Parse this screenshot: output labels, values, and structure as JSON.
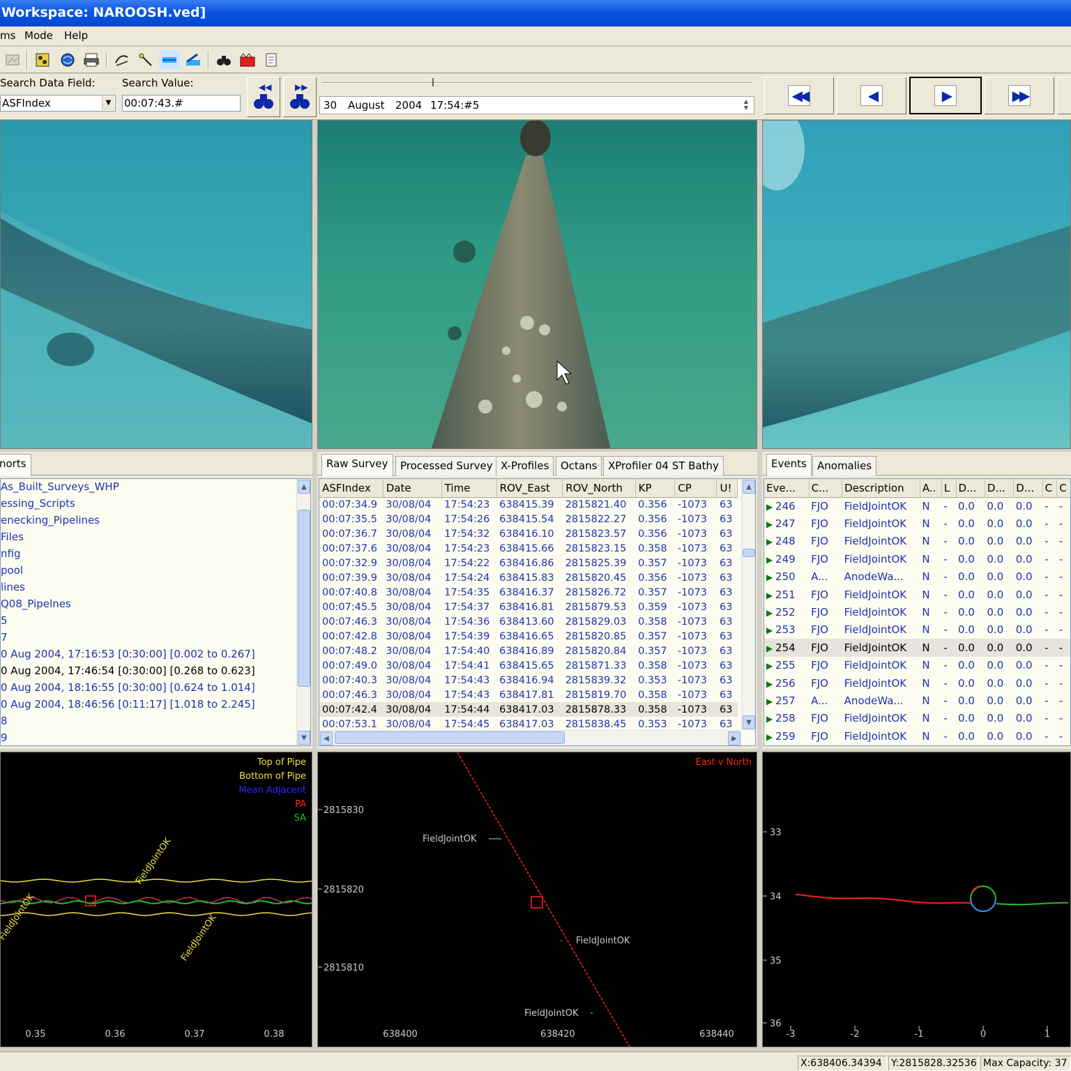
{
  "window": {
    "title": "Workspace: NAROOSH.ved]"
  },
  "menu": [
    "ms",
    "Mode",
    "Help"
  ],
  "toolbar": {
    "icons": [
      "image-icon",
      "filter-icon",
      "globe-icon",
      "print-icon",
      "cable-icon",
      "probe-icon",
      "layers-icon",
      "chart-icon",
      "binoculars-icon",
      "video-icon",
      "report-icon"
    ]
  },
  "search": {
    "field_label": "Search Data Field:",
    "field_value": "ASFIndex",
    "value_label": "Search Value:",
    "value": "00:07:43.#"
  },
  "datetime": {
    "day": "30",
    "month": "August",
    "year": "2004",
    "time": "17:54:#5"
  },
  "nav": {
    "first": "first-record-icon",
    "prev": "previous-record-icon",
    "next": "next-record-icon",
    "last": "last-record-icon"
  },
  "left_panel": {
    "tab": "norts",
    "items": [
      {
        "label": "As_Built_Surveys_WHP",
        "color": "blue"
      },
      {
        "label": "essing_Scripts",
        "color": "blue"
      },
      {
        "label": "enecking_Pipelines",
        "color": "blue"
      },
      {
        "label": "Files",
        "color": "blue"
      },
      {
        "label": "nfig",
        "color": "blue"
      },
      {
        "label": "pool",
        "color": "blue"
      },
      {
        "label": "lines",
        "color": "blue"
      },
      {
        "label": "Q08_Pipelnes",
        "color": "blue"
      },
      {
        "label": "5",
        "color": "blue"
      },
      {
        "label": "7",
        "color": "blue"
      },
      {
        "label": "0 Aug 2004, 17:16:53 [0:30:00] [0.002 to 0.267]",
        "color": "blue"
      },
      {
        "label": "0 Aug 2004, 17:46:54 [0:30:00] [0.268 to 0.623]",
        "color": "black"
      },
      {
        "label": "0 Aug 2004, 18:16:55 [0:30:00] [0.624 to 1.014]",
        "color": "blue"
      },
      {
        "label": "0 Aug 2004, 18:46:56 [0:11:17] [1.018 to 2.245]",
        "color": "blue"
      },
      {
        "label": "8",
        "color": "blue"
      },
      {
        "label": "9",
        "color": "blue"
      }
    ]
  },
  "survey_tabs": [
    "Raw Survey",
    "Processed Survey",
    "X-Profiles",
    "Octans",
    "XProfiler 04 ST Bathy"
  ],
  "survey_columns": [
    "ASFIndex",
    "Date",
    "Time",
    "ROV_East",
    "ROV_North",
    "KP",
    "CP",
    "U!"
  ],
  "survey_rows": [
    [
      "00:07:34.9",
      "30/08/04",
      "17:54:23",
      "638415.39",
      "2815821.40",
      "0.356",
      "-1073",
      "63"
    ],
    [
      "00:07:35.5",
      "30/08/04",
      "17:54:26",
      "638415.54",
      "2815822.27",
      "0.356",
      "-1073",
      "63"
    ],
    [
      "00:07:36.7",
      "30/08/04",
      "17:54:32",
      "638416.10",
      "2815823.57",
      "0.356",
      "-1073",
      "63"
    ],
    [
      "00:07:37.6",
      "30/08/04",
      "17:54:23",
      "638415.66",
      "2815823.15",
      "0.358",
      "-1073",
      "63"
    ],
    [
      "00:07:32.9",
      "30/08/04",
      "17:54:22",
      "638416.86",
      "2815825.39",
      "0.357",
      "-1073",
      "63"
    ],
    [
      "00:07:39.9",
      "30/08/04",
      "17:54:24",
      "638415.83",
      "2815820.45",
      "0.356",
      "-1073",
      "63"
    ],
    [
      "00:07:40.8",
      "30/08/04",
      "17:54:35",
      "638416.37",
      "2815826.72",
      "0.357",
      "-1073",
      "63"
    ],
    [
      "00:07:45.5",
      "30/08/04",
      "17:54:37",
      "638416.81",
      "2815879.53",
      "0.359",
      "-1073",
      "63"
    ],
    [
      "00:07:46.3",
      "30/08/04",
      "17:54:36",
      "638413.60",
      "2815829.03",
      "0.358",
      "-1073",
      "63"
    ],
    [
      "00:07:42.8",
      "30/08/04",
      "17:54:39",
      "638416.65",
      "2815820.85",
      "0.357",
      "-1073",
      "63"
    ],
    [
      "00:07:48.2",
      "30/08/04",
      "17:54:40",
      "638416.89",
      "2815820.84",
      "0.357",
      "-1073",
      "63"
    ],
    [
      "00:07:49.0",
      "30/08/04",
      "17:54:41",
      "638415.65",
      "2815871.33",
      "0.358",
      "-1073",
      "63"
    ],
    [
      "00:07:40.3",
      "30/08/04",
      "17:54:43",
      "638416.94",
      "2815839.32",
      "0.353",
      "-1073",
      "63"
    ],
    [
      "00:07:46.3",
      "30/08/04",
      "17:54:43",
      "638417.81",
      "2815819.70",
      "0.358",
      "-1073",
      "63"
    ],
    [
      "00:07:42.4",
      "30/08/04",
      "17:54:44",
      "638417.03",
      "2815878.33",
      "0.358",
      "-1073",
      "63"
    ],
    [
      "00:07:53.1",
      "30/08/04",
      "17:54:45",
      "638417.03",
      "2815838.45",
      "0.353",
      "-1073",
      "63"
    ]
  ],
  "event_tabs": [
    "Events",
    "Anomalies"
  ],
  "event_columns": [
    "Eve...",
    "C...",
    "Description",
    "A..",
    "L",
    "D...",
    "D...",
    "D...",
    "C",
    "C"
  ],
  "event_rows": [
    [
      "246",
      "FJO",
      "FieldJointOK",
      "N",
      "-",
      "0.0",
      "0.0",
      "0.0",
      "-",
      "-"
    ],
    [
      "247",
      "FJO",
      "FieldJointOK",
      "N",
      "-",
      "0.0",
      "0.0",
      "0.0",
      "-",
      "-"
    ],
    [
      "248",
      "FJO",
      "FieldJointOK",
      "N",
      "-",
      "0.0",
      "0.0",
      "0.0",
      "-",
      "-"
    ],
    [
      "249",
      "FJO",
      "FieldJointOK",
      "N",
      "-",
      "0.0",
      "0.0",
      "0.0",
      "-",
      "-"
    ],
    [
      "250",
      "A...",
      "AnodeWa...",
      "N",
      "-",
      "0.0",
      "0.0",
      "0.0",
      "-",
      "-"
    ],
    [
      "251",
      "FJO",
      "FieldJointOK",
      "N",
      "-",
      "0.0",
      "0.0",
      "0.0",
      "-",
      "-"
    ],
    [
      "252",
      "FJO",
      "FieldJointOK",
      "N",
      "-",
      "0.0",
      "0.0",
      "0.0",
      "-",
      "-"
    ],
    [
      "253",
      "FJO",
      "FieldJointOK",
      "N",
      "-",
      "0.0",
      "0.0",
      "0.0",
      "-",
      "-"
    ],
    [
      "254",
      "FJO",
      "FieldJointOK",
      "N",
      "-",
      "0.0",
      "0.0",
      "0.0",
      "-",
      "-"
    ],
    [
      "255",
      "FJO",
      "FieldJointOK",
      "N",
      "-",
      "0.0",
      "0.0",
      "0.0",
      "-",
      "-"
    ],
    [
      "256",
      "FJO",
      "FieldJointOK",
      "N",
      "-",
      "0.0",
      "0.0",
      "0.0",
      "-",
      "-"
    ],
    [
      "257",
      "A...",
      "AnodeWa...",
      "N",
      "-",
      "0.0",
      "0.0",
      "0.0",
      "-",
      "-"
    ],
    [
      "258",
      "FJO",
      "FieldJointOK",
      "N",
      "-",
      "0.0",
      "0.0",
      "0.0",
      "-",
      "-"
    ],
    [
      "259",
      "FJO",
      "FieldJointOK",
      "N",
      "-",
      "0.0",
      "0.0",
      "0.0",
      "-",
      "-"
    ]
  ],
  "profile_plot": {
    "legend": [
      {
        "label": "Top of Pipe",
        "color": "#f0e040"
      },
      {
        "label": "Bottom of Pipe",
        "color": "#f0e040"
      },
      {
        "label": "Mean Adjacent",
        "color": "#2a2aff"
      },
      {
        "label": "PA",
        "color": "#ff2020"
      },
      {
        "label": "SA",
        "color": "#20c020"
      }
    ],
    "x_ticks": [
      "0.35",
      "0.36",
      "0.37",
      "0.38"
    ],
    "annotations": [
      "FieldJointOK",
      "FieldJointOK",
      "FieldJointOK"
    ]
  },
  "track_plot": {
    "legend": "East v North",
    "y_ticks": [
      "2815830",
      "2815820",
      "2815810"
    ],
    "x_ticks": [
      "638400",
      "638420",
      "638440"
    ],
    "annotations": [
      "FieldJointOK",
      "FieldJointOK",
      "FieldJointOK"
    ]
  },
  "xsection_plot": {
    "y_ticks": [
      "33",
      "34",
      "35",
      "36"
    ],
    "x_ticks": [
      "-3",
      "-2",
      "-1",
      "0",
      "1"
    ]
  },
  "status": {
    "x": "X:638406.34394",
    "y": "Y:2815828.32536",
    "capacity": "Max Capacity: 37"
  }
}
